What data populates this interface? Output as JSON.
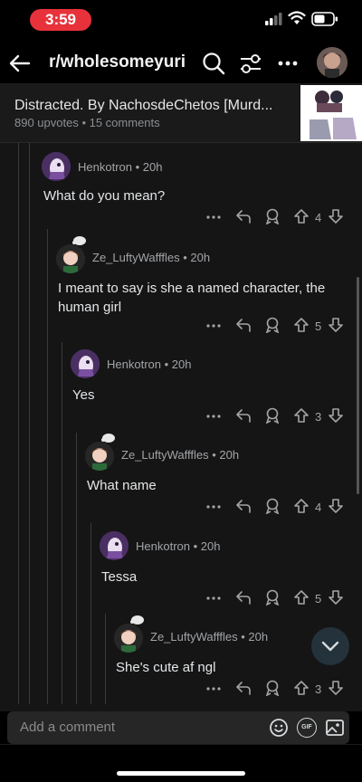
{
  "status_bar": {
    "time": "3:59",
    "time_pill_color": "#e8323b"
  },
  "nav": {
    "subreddit": "r/wholesomeyuri",
    "icons": [
      "back-arrow-icon",
      "search-icon",
      "filter-sliders-icon",
      "more-horizontal-icon",
      "user-avatar"
    ]
  },
  "post": {
    "title": "Distracted. By NachosdeChetos [Murd...",
    "meta": "890 upvotes • 15 comments"
  },
  "comments": [
    {
      "user": "Henkotron • 20h",
      "body": "What do you mean?",
      "votes": "4"
    },
    {
      "user": "Ze_LuftyWafffles • 20h",
      "body": "I meant to say is she a named character, the human girl",
      "votes": "5"
    },
    {
      "user": "Henkotron • 20h",
      "body": "Yes",
      "votes": "3"
    },
    {
      "user": "Ze_LuftyWafffles • 20h",
      "body": "What name",
      "votes": "4"
    },
    {
      "user": "Henkotron • 20h",
      "body": "Tessa",
      "votes": "5"
    },
    {
      "user": "Ze_LuftyWafffles • 20h",
      "body": "She's cute af ngl",
      "votes": "3"
    }
  ],
  "comment_bar": {
    "placeholder": "Add a comment",
    "gif_label": "GIF"
  }
}
